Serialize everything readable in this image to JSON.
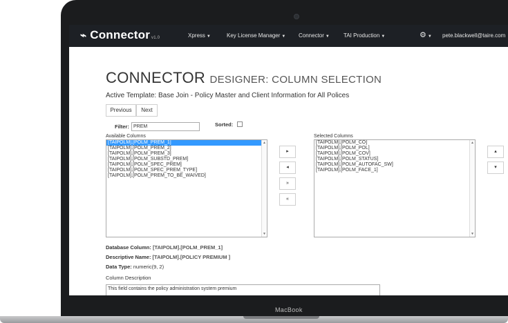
{
  "device": {
    "label": "MacBook"
  },
  "nav": {
    "brand": "Connector",
    "version": "v1.0",
    "items": [
      {
        "label": "Xpress"
      },
      {
        "label": "Key License Manager"
      },
      {
        "label": "Connector"
      },
      {
        "label": "TAI Production"
      }
    ],
    "user": "pete.blackwell@taire.com"
  },
  "page": {
    "title": "CONNECTOR",
    "subtitle": "DESIGNER: COLUMN SELECTION",
    "active_template_label": "Active Template:",
    "active_template_value": "Base Join - Policy Master and Client Information for All Polices",
    "previous_label": "Previous",
    "next_label": "Next",
    "filter_label": "Filter:",
    "filter_value": "PREM",
    "sorted_label": "Sorted:",
    "sorted_checked": false
  },
  "available": {
    "label": "Available Columns",
    "items": [
      {
        "text": "[TAIPOLM].[POLM_PREM_1]",
        "selected": true
      },
      {
        "text": "[TAIPOLM].[POLM_PREM_2]",
        "selected": false
      },
      {
        "text": "[TAIPOLM].[POLM_PREM_3]",
        "selected": false
      },
      {
        "text": "[TAIPOLM].[POLM_SUBSTD_PREM]",
        "selected": false
      },
      {
        "text": "[TAIPOLM].[POLM_SPEC_PREM]",
        "selected": false
      },
      {
        "text": "[TAIPOLM].[POLM_SPEC_PREM_TYPE]",
        "selected": false
      },
      {
        "text": "[TAIPOLM].[POLM_PREM_TO_BE_WAIVED]",
        "selected": false
      }
    ]
  },
  "selected": {
    "label": "Selected Columns",
    "items": [
      {
        "text": "[TAIPOLM].[POLM_CO]"
      },
      {
        "text": "[TAIPOLM].[POLM_POL]"
      },
      {
        "text": "[TAIPOLM].[POLM_COV]"
      },
      {
        "text": "[TAIPOLM].[POLM_STATUS]"
      },
      {
        "text": "[TAIPOLM].[POLM_AUTOFAC_SW]"
      },
      {
        "text": "[TAIPOLM].[POLM_FACE_1]"
      }
    ]
  },
  "details": {
    "db_column_label": "Database Column:",
    "db_column_value": "[TAIPOLM].[POLM_PREM_1]",
    "desc_name_label": "Descriptive Name:",
    "desc_name_value": "[TAIPOLM].[POLICY PREMIUM ]",
    "data_type_label": "Data Type:",
    "data_type_value": "numeric(9, 2)",
    "column_description_label": "Column Description",
    "column_description_value": "This field contains the policy administration system premium"
  }
}
